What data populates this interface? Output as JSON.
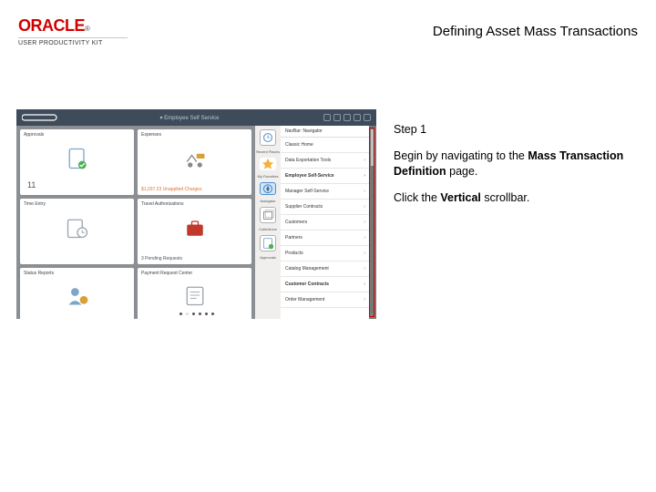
{
  "header": {
    "brand": "ORACLE",
    "sub": "USER PRODUCTIVITY KIT",
    "title": "Defining Asset Mass Transactions"
  },
  "instruction": {
    "step": "Step 1",
    "line1_a": "Begin by navigating to the ",
    "line1_b": "Mass Transaction Definition",
    "line1_c": " page.",
    "line2_a": "Click the ",
    "line2_b": "Vertical",
    "line2_c": " scrollbar."
  },
  "app": {
    "topbar_center": "▾ Employee Self Service",
    "tiles": [
      {
        "label": "Approvals",
        "footer": "11"
      },
      {
        "label": "Expenses",
        "footer": "$1,037.23 Unapplied Charges"
      },
      {
        "label": "Time Entry"
      },
      {
        "label": "Travel Authorizations",
        "footer": "3 Pending Requests"
      },
      {
        "label": "Status Reports"
      },
      {
        "label": "Payment Request Center"
      }
    ],
    "nav_title": "NavBar: Navigator",
    "nav_side": [
      {
        "label": "Recent Places"
      },
      {
        "label": "My Favorites"
      },
      {
        "label": "Navigator"
      },
      {
        "label": "Collections"
      },
      {
        "label": "Approvals"
      }
    ],
    "nav_items": [
      "Classic Home",
      "Data Exportation Tools",
      "Employee Self-Service",
      "Manager Self-Service",
      "Supplier Contracts",
      "Customers",
      "Partners",
      "Products",
      "Catalog Management",
      "Customer Contracts",
      "Order Management"
    ]
  }
}
